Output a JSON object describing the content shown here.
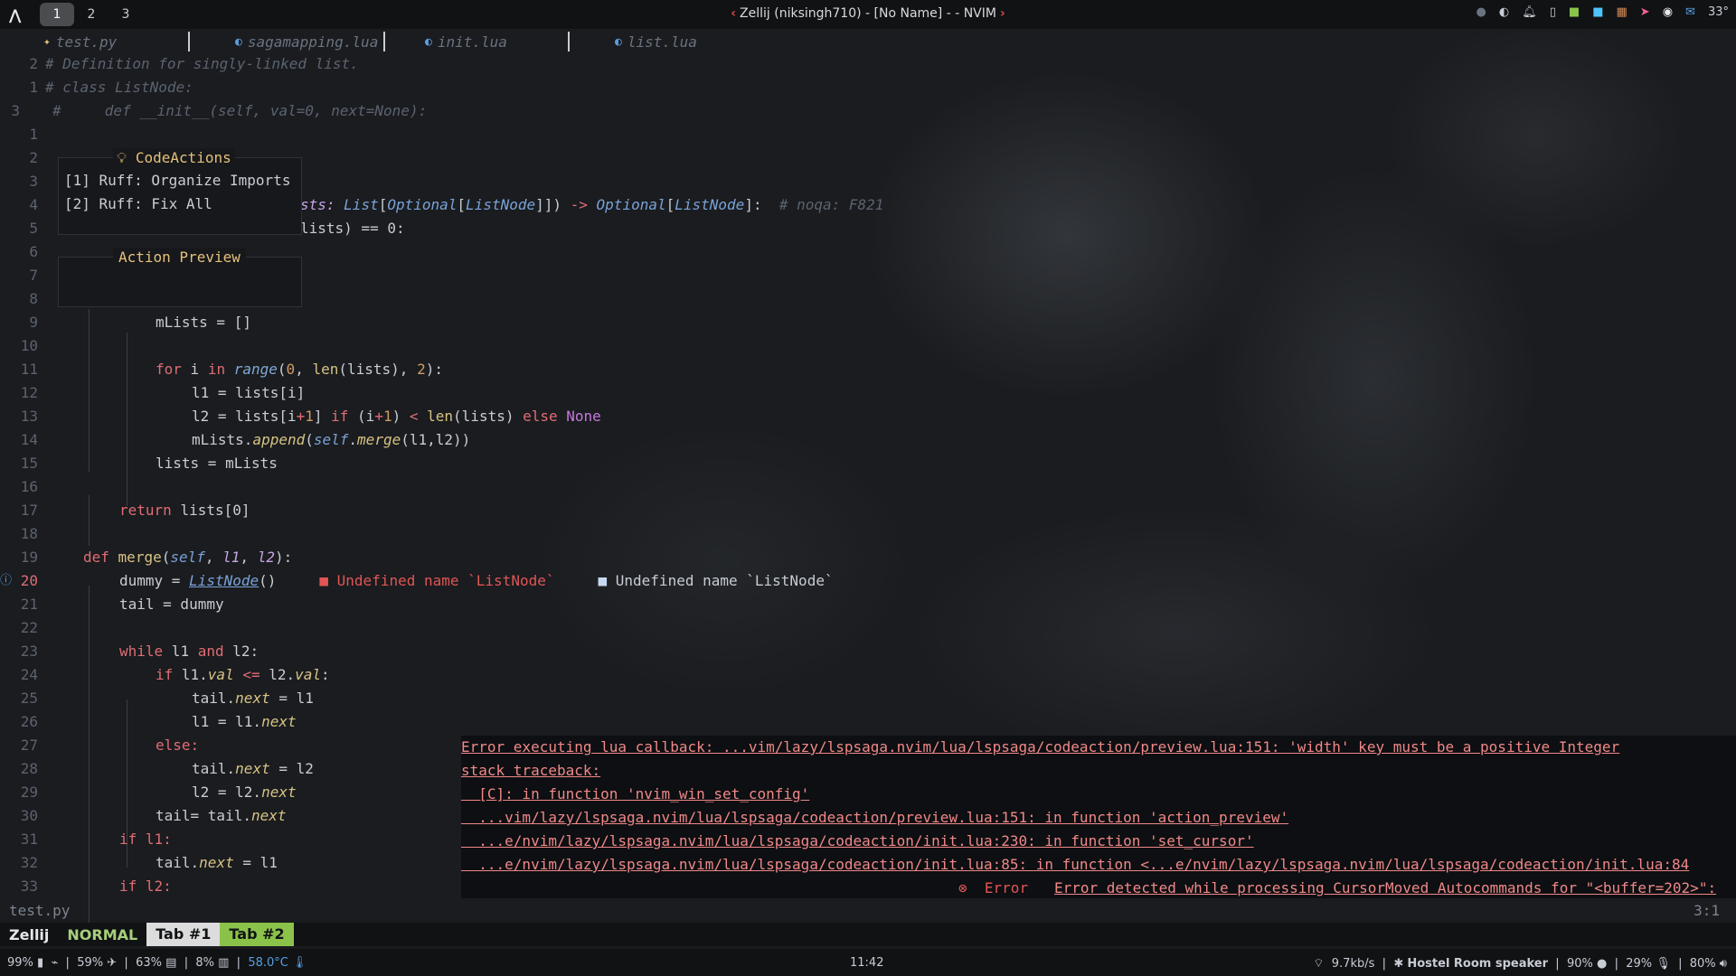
{
  "topbar": {
    "workspaces": [
      "1",
      "2",
      "3"
    ],
    "window_title": "Zellij (niksingh710) - [No Name] - - NVIM",
    "temperature": "33°"
  },
  "buffers": [
    {
      "name": "test.py",
      "icon": "python-icon"
    },
    {
      "name": "sagamapping.lua",
      "icon": "lua-icon"
    },
    {
      "name": "init.lua",
      "icon": "lua-icon"
    },
    {
      "name": "list.lua",
      "icon": "lua-icon"
    }
  ],
  "code_actions": {
    "title": "CodeActions",
    "items": [
      "[1] Ruff: Organize Imports",
      "[2] Ruff: Fix All"
    ],
    "preview_title": "Action Preview"
  },
  "lines": {
    "l0": {
      "num": "2",
      "text": "# Definition for singly-linked list."
    },
    "l1": {
      "num": "1",
      "text": "# class ListNode:"
    },
    "l2": {
      "num": "3",
      "text": "#     def __init__(self, val=0, next=None):"
    },
    "l3": {
      "num": "1"
    },
    "l4": {
      "num": "2"
    },
    "l5": {
      "num": "3"
    },
    "l6": {
      "num": "4",
      "a": "sts: ",
      "b": "List",
      "c": "[",
      "d": "Optional",
      "e": "[",
      "f": "ListNode",
      "g": "]]) ",
      "h": "->",
      "i": " Optional",
      "j": "[",
      "k": "ListNode",
      "l": "]:  ",
      "m": "# noqa: F821"
    },
    "l7": {
      "num": "5",
      "text": "lists) == 0:"
    },
    "l8": {
      "num": "6"
    },
    "l9": {
      "num": "7"
    },
    "l10": {
      "num": "8"
    },
    "l11": {
      "num": "9"
    },
    "l12": {
      "num": "10"
    },
    "l13": {
      "num": "11"
    },
    "l14": {
      "num": "12"
    },
    "l15": {
      "num": "13"
    },
    "l16": {
      "num": "14"
    },
    "l17": {
      "num": "15"
    },
    "l18": {
      "num": "16"
    },
    "l19": {
      "num": "17"
    },
    "l20": {
      "num": "18"
    },
    "l21": {
      "num": "19"
    },
    "l22": {
      "num": "20"
    },
    "l23": {
      "num": "21"
    },
    "l24": {
      "num": "22"
    },
    "l25": {
      "num": "23"
    },
    "l26": {
      "num": "24"
    },
    "l27": {
      "num": "25"
    },
    "l28": {
      "num": "26"
    },
    "l29": {
      "num": "27"
    },
    "l30": {
      "num": "28"
    },
    "l31": {
      "num": "29"
    },
    "l32": {
      "num": "30"
    },
    "l33": {
      "num": "31"
    },
    "l34": {
      "num": "32"
    },
    "l35": {
      "num": "33"
    }
  },
  "code": {
    "while": "while",
    "len": "len",
    "lists": "lists",
    "gt": ">",
    "one": "1",
    "mLists_eq": "mLists = []",
    "for": "for",
    "i": "i",
    "in": "in",
    "range": "range",
    "zero": "0",
    "two": "2",
    "l1_assign": "l1 = lists[i]",
    "l2_assign": "l2 = lists[i",
    "plus": "+",
    "if": "if",
    "lt": "<",
    "else": "else",
    "none": "None",
    "mlists": "mLists",
    "append": "append",
    "self": "self",
    "merge": "merge",
    "l1l2": "(l1,l2))",
    "lists_eq": "lists = mLists",
    "return": "return",
    "lists0": "lists[0]",
    "def": "def",
    "l1p": "l1",
    "l2p": "l2",
    "dummy": "dummy = ",
    "ListNode": "ListNode",
    "parens": "()",
    "diag_error": "Undefined name `ListNode`",
    "diag_plain": "Undefined name `ListNode`",
    "tail_dummy": "tail = dummy",
    "and": "and",
    "val": "val",
    "lte": "<=",
    "tail": "tail",
    "next": "next",
    "eq_l1": " = l1",
    "l1eq": "l1 = l1.",
    "eq_l2": " = l2",
    "l2eq": "l2 = l2.",
    "tail_eq": "tail= tail.",
    "if_l1": "if l1:",
    "if_l2": "if l2:",
    "else_colon": "else:"
  },
  "error": {
    "line1": "Error executing lua callback: ...vim/lazy/lspsaga.nvim/lua/lspsaga/codeaction/preview.lua:151: 'width' key must be a positive Integer",
    "line2": "stack traceback:",
    "line3": "  [C]: in function 'nvim_win_set_config'",
    "line4": "  ...vim/lazy/lspsaga.nvim/lua/lspsaga/codeaction/preview.lua:151: in function 'action_preview'",
    "line5": "  ...e/nvim/lazy/lspsaga.nvim/lua/lspsaga/codeaction/init.lua:230: in function 'set_cursor'",
    "line6": "  ...e/nvim/lazy/lspsaga.nvim/lua/lspsaga/codeaction/init.lua:85: in function <...e/nvim/lazy/lspsaga.nvim/lua/lspsaga/codeaction/init.lua:84",
    "notify_label": "Error",
    "notify_text": "Error detected while processing CursorMoved Autocommands for \"<buffer=202>\":"
  },
  "status": {
    "filename": "test.py",
    "position": "3:1"
  },
  "zellij": {
    "name": "Zellij",
    "mode": "NORMAL",
    "tabs": [
      "Tab #1",
      "Tab #2"
    ]
  },
  "system": {
    "battery": "99%",
    "cpu": "59%",
    "mem": "63%",
    "disk": "8%",
    "temp": "58.0°C",
    "clock": "11:42",
    "net": "9.7kb/s",
    "bt": "Hostel Room speaker",
    "brightness": "90%",
    "mic": "29%",
    "volume": "80%"
  },
  "colors": {
    "accent_red": "#e06c75",
    "error_red": "#e05555",
    "zellij_green": "#8bc34a",
    "active_ws": "#4a4c50"
  }
}
